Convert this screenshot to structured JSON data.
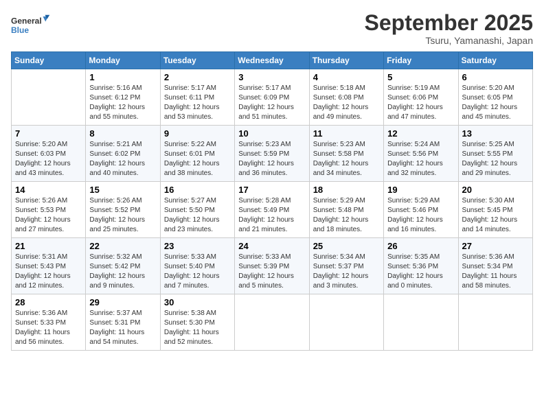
{
  "header": {
    "logo_line1": "General",
    "logo_line2": "Blue",
    "month": "September 2025",
    "location": "Tsuru, Yamanashi, Japan"
  },
  "days_of_week": [
    "Sunday",
    "Monday",
    "Tuesday",
    "Wednesday",
    "Thursday",
    "Friday",
    "Saturday"
  ],
  "weeks": [
    [
      {
        "day": "",
        "info": ""
      },
      {
        "day": "1",
        "info": "Sunrise: 5:16 AM\nSunset: 6:12 PM\nDaylight: 12 hours\nand 55 minutes."
      },
      {
        "day": "2",
        "info": "Sunrise: 5:17 AM\nSunset: 6:11 PM\nDaylight: 12 hours\nand 53 minutes."
      },
      {
        "day": "3",
        "info": "Sunrise: 5:17 AM\nSunset: 6:09 PM\nDaylight: 12 hours\nand 51 minutes."
      },
      {
        "day": "4",
        "info": "Sunrise: 5:18 AM\nSunset: 6:08 PM\nDaylight: 12 hours\nand 49 minutes."
      },
      {
        "day": "5",
        "info": "Sunrise: 5:19 AM\nSunset: 6:06 PM\nDaylight: 12 hours\nand 47 minutes."
      },
      {
        "day": "6",
        "info": "Sunrise: 5:20 AM\nSunset: 6:05 PM\nDaylight: 12 hours\nand 45 minutes."
      }
    ],
    [
      {
        "day": "7",
        "info": "Sunrise: 5:20 AM\nSunset: 6:03 PM\nDaylight: 12 hours\nand 43 minutes."
      },
      {
        "day": "8",
        "info": "Sunrise: 5:21 AM\nSunset: 6:02 PM\nDaylight: 12 hours\nand 40 minutes."
      },
      {
        "day": "9",
        "info": "Sunrise: 5:22 AM\nSunset: 6:01 PM\nDaylight: 12 hours\nand 38 minutes."
      },
      {
        "day": "10",
        "info": "Sunrise: 5:23 AM\nSunset: 5:59 PM\nDaylight: 12 hours\nand 36 minutes."
      },
      {
        "day": "11",
        "info": "Sunrise: 5:23 AM\nSunset: 5:58 PM\nDaylight: 12 hours\nand 34 minutes."
      },
      {
        "day": "12",
        "info": "Sunrise: 5:24 AM\nSunset: 5:56 PM\nDaylight: 12 hours\nand 32 minutes."
      },
      {
        "day": "13",
        "info": "Sunrise: 5:25 AM\nSunset: 5:55 PM\nDaylight: 12 hours\nand 29 minutes."
      }
    ],
    [
      {
        "day": "14",
        "info": "Sunrise: 5:26 AM\nSunset: 5:53 PM\nDaylight: 12 hours\nand 27 minutes."
      },
      {
        "day": "15",
        "info": "Sunrise: 5:26 AM\nSunset: 5:52 PM\nDaylight: 12 hours\nand 25 minutes."
      },
      {
        "day": "16",
        "info": "Sunrise: 5:27 AM\nSunset: 5:50 PM\nDaylight: 12 hours\nand 23 minutes."
      },
      {
        "day": "17",
        "info": "Sunrise: 5:28 AM\nSunset: 5:49 PM\nDaylight: 12 hours\nand 21 minutes."
      },
      {
        "day": "18",
        "info": "Sunrise: 5:29 AM\nSunset: 5:48 PM\nDaylight: 12 hours\nand 18 minutes."
      },
      {
        "day": "19",
        "info": "Sunrise: 5:29 AM\nSunset: 5:46 PM\nDaylight: 12 hours\nand 16 minutes."
      },
      {
        "day": "20",
        "info": "Sunrise: 5:30 AM\nSunset: 5:45 PM\nDaylight: 12 hours\nand 14 minutes."
      }
    ],
    [
      {
        "day": "21",
        "info": "Sunrise: 5:31 AM\nSunset: 5:43 PM\nDaylight: 12 hours\nand 12 minutes."
      },
      {
        "day": "22",
        "info": "Sunrise: 5:32 AM\nSunset: 5:42 PM\nDaylight: 12 hours\nand 9 minutes."
      },
      {
        "day": "23",
        "info": "Sunrise: 5:33 AM\nSunset: 5:40 PM\nDaylight: 12 hours\nand 7 minutes."
      },
      {
        "day": "24",
        "info": "Sunrise: 5:33 AM\nSunset: 5:39 PM\nDaylight: 12 hours\nand 5 minutes."
      },
      {
        "day": "25",
        "info": "Sunrise: 5:34 AM\nSunset: 5:37 PM\nDaylight: 12 hours\nand 3 minutes."
      },
      {
        "day": "26",
        "info": "Sunrise: 5:35 AM\nSunset: 5:36 PM\nDaylight: 12 hours\nand 0 minutes."
      },
      {
        "day": "27",
        "info": "Sunrise: 5:36 AM\nSunset: 5:34 PM\nDaylight: 11 hours\nand 58 minutes."
      }
    ],
    [
      {
        "day": "28",
        "info": "Sunrise: 5:36 AM\nSunset: 5:33 PM\nDaylight: 11 hours\nand 56 minutes."
      },
      {
        "day": "29",
        "info": "Sunrise: 5:37 AM\nSunset: 5:31 PM\nDaylight: 11 hours\nand 54 minutes."
      },
      {
        "day": "30",
        "info": "Sunrise: 5:38 AM\nSunset: 5:30 PM\nDaylight: 11 hours\nand 52 minutes."
      },
      {
        "day": "",
        "info": ""
      },
      {
        "day": "",
        "info": ""
      },
      {
        "day": "",
        "info": ""
      },
      {
        "day": "",
        "info": ""
      }
    ]
  ]
}
